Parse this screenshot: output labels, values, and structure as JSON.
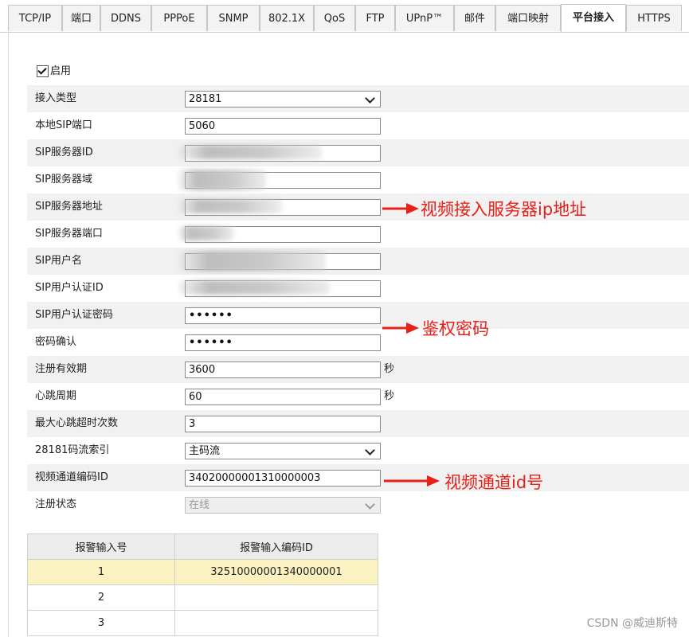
{
  "tabs": [
    "TCP/IP",
    "端口",
    "DDNS",
    "PPPoE",
    "SNMP",
    "802.1X",
    "QoS",
    "FTP",
    "UPnP™",
    "邮件",
    "端口映射",
    "平台接入",
    "HTTPS"
  ],
  "active_tab": "平台接入",
  "enable_label": "启用",
  "fields": {
    "access_type": {
      "label": "接入类型",
      "value": "28181"
    },
    "local_sip_port": {
      "label": "本地SIP端口",
      "value": "5060"
    },
    "sip_server_id": {
      "label": "SIP服务器ID",
      "value": ""
    },
    "sip_server_domain": {
      "label": "SIP服务器域",
      "value": ""
    },
    "sip_server_addr": {
      "label": "SIP服务器地址",
      "value": ""
    },
    "sip_server_port": {
      "label": "SIP服务器端口",
      "value": ""
    },
    "sip_username": {
      "label": "SIP用户名",
      "value": ""
    },
    "sip_auth_id": {
      "label": "SIP用户认证ID",
      "value": ""
    },
    "sip_auth_password": {
      "label": "SIP用户认证密码",
      "value": "••••••"
    },
    "password_confirm": {
      "label": "密码确认",
      "value": "••••••"
    },
    "register_validity": {
      "label": "注册有效期",
      "value": "3600",
      "unit": "秒"
    },
    "heartbeat_period": {
      "label": "心跳周期",
      "value": "60",
      "unit": "秒"
    },
    "max_heartbeat_timeouts": {
      "label": "最大心跳超时次数",
      "value": "3"
    },
    "stream_index": {
      "label": "28181码流索引",
      "value": "主码流"
    },
    "video_channel_id": {
      "label": "视频通道编码ID",
      "value": "34020000001310000003"
    },
    "register_status": {
      "label": "注册状态",
      "value": "在线"
    }
  },
  "annotations": {
    "server_ip": "视频接入服务器ip地址",
    "auth_password": "鉴权密码",
    "channel_id": "视频通道id号"
  },
  "alarm_table": {
    "headers": [
      "报警输入号",
      "报警输入编码ID"
    ],
    "rows": [
      {
        "no": "1",
        "id": "32510000001340000001"
      },
      {
        "no": "2",
        "id": ""
      },
      {
        "no": "3",
        "id": ""
      }
    ]
  },
  "watermark": "CSDN @威迪斯特",
  "colors": {
    "annotation": "#e8201a",
    "selected_row": "#fbf2c2",
    "row_shade": "#f1f1f1"
  }
}
